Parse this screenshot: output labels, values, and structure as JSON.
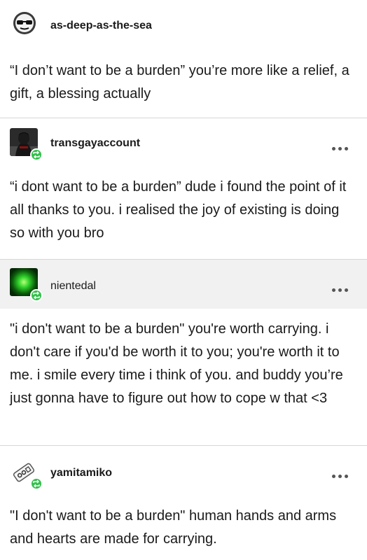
{
  "posts": [
    {
      "username": "as-deep-as-the-sea",
      "text": "“I don’t want to be a burden” you’re more like a relief, a gift, a blessing actually"
    },
    {
      "username": "transgayaccount",
      "text": "“i dont want to be a burden” dude i found the point of it all thanks to you. i realised the joy of existing is doing so with you bro"
    },
    {
      "username": "nientedal",
      "text": "\"i don't want to be a burden\" you're worth carrying. i don't care if you'd be worth it to you; you're worth it to me. i smile every time i think of you. and buddy you’re just gonna have to figure out how to cope w that <3"
    },
    {
      "username": "yamitamiko",
      "text": "\"I don't want to be a burden\" human hands and arms and hearts are made for carrying."
    }
  ],
  "colors": {
    "reblog_badge": "#33c04b",
    "header_gray": "#f1f1f1",
    "divider": "#d6d6d6"
  },
  "icons": {
    "avatar1": "sunglasses-face-icon",
    "avatar2": "dark-figure-photo",
    "avatar3": "green-glow-photo",
    "avatar4": "sticker-icon",
    "reblog": "reblog-icon",
    "more": "more-options-icon"
  }
}
